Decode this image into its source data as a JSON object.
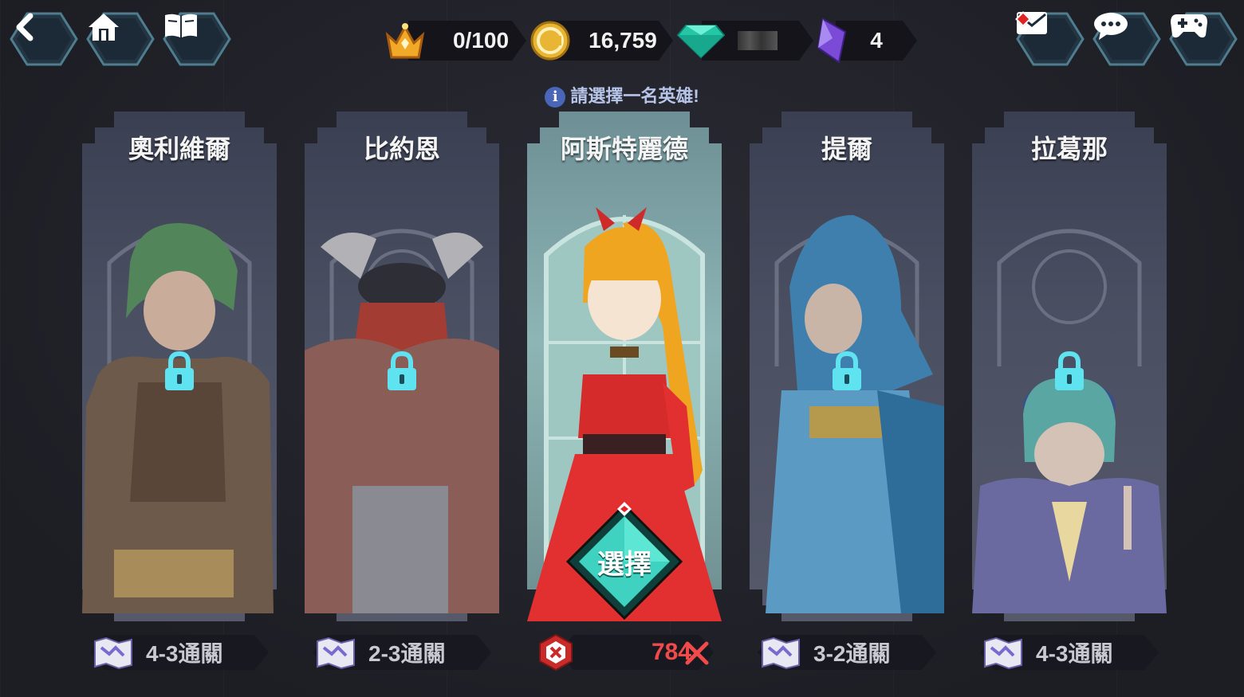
{
  "nav": {
    "back_icon": "back-arrow-icon",
    "home_icon": "home-icon",
    "book_icon": "book-icon"
  },
  "currencies": {
    "crown": {
      "icon": "crown-icon",
      "value": "0/100"
    },
    "gold": {
      "icon": "gold-coin-icon",
      "value": "16,759"
    },
    "gem": {
      "icon": "gem-icon",
      "value": ""
    },
    "crystal": {
      "icon": "purple-crystal-icon",
      "value": "4"
    }
  },
  "top_right": {
    "mail_icon": "mail-icon",
    "chat_icon": "chat-icon",
    "gamepad_icon": "gamepad-icon"
  },
  "hint": "請選擇一名英雄!",
  "heroes": [
    {
      "name": "奧利維爾",
      "locked": true,
      "stage": "4-3通關"
    },
    {
      "name": "比約恩",
      "locked": true,
      "stage": "2-3通關"
    },
    {
      "name": "阿斯特麗德",
      "locked": false,
      "select_label": "選擇",
      "count": "784"
    },
    {
      "name": "提爾",
      "locked": true,
      "stage": "3-2通關"
    },
    {
      "name": "拉葛那",
      "locked": true,
      "stage": "4-3通關"
    }
  ],
  "colors": {
    "accent_teal": "#3fd2c0",
    "lock_cyan": "#5fe3f0",
    "count_red": "#f14a4a",
    "hex_border": "#3a5a6a"
  }
}
